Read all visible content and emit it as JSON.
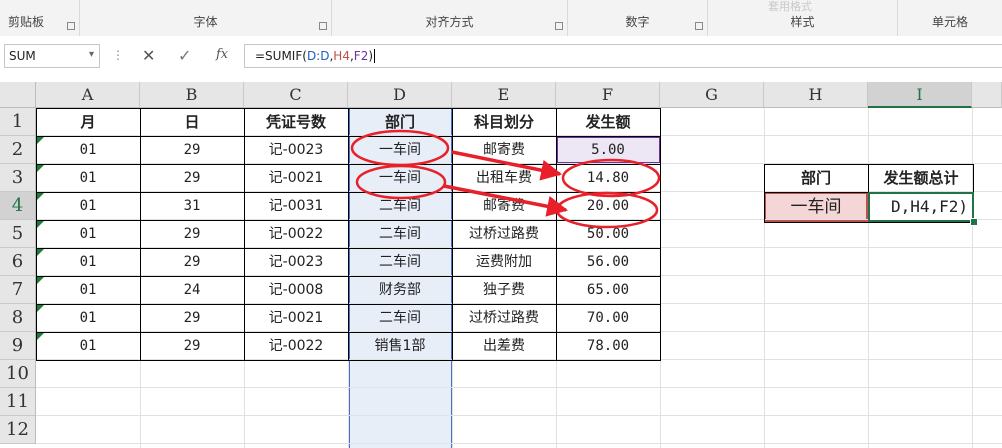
{
  "ribbon": {
    "groups": [
      "剪贴板",
      "字体",
      "对齐方式",
      "数字",
      "样式",
      "单元格"
    ],
    "ghost_text": "套用格式"
  },
  "formula_bar": {
    "name_box": "SUM",
    "cancel_icon": "✕",
    "enter_icon": "✓",
    "fx_label": "fx",
    "formula_prefix": "=SUMIF(",
    "formula_range": "D:D",
    "formula_comma1": ",",
    "formula_crit": "H4",
    "formula_comma2": ",",
    "formula_sum": "F2",
    "formula_suffix": ")"
  },
  "columns": [
    "A",
    "B",
    "C",
    "D",
    "E",
    "F",
    "G",
    "H",
    "I"
  ],
  "rows": [
    "1",
    "2",
    "3",
    "4",
    "5",
    "6",
    "7",
    "8",
    "9",
    "10",
    "11",
    "12"
  ],
  "table": {
    "headers": [
      "月",
      "日",
      "凭证号数",
      "部门",
      "科目划分",
      "发生额"
    ],
    "data": [
      [
        "01",
        "29",
        "记-0023",
        "一车间",
        "邮寄费",
        "5.00"
      ],
      [
        "01",
        "29",
        "记-0021",
        "一车间",
        "出租车费",
        "14.80"
      ],
      [
        "01",
        "31",
        "记-0031",
        "二车间",
        "邮寄费",
        "20.00"
      ],
      [
        "01",
        "29",
        "记-0022",
        "二车间",
        "过桥过路费",
        "50.00"
      ],
      [
        "01",
        "29",
        "记-0023",
        "二车间",
        "运费附加",
        "56.00"
      ],
      [
        "01",
        "24",
        "记-0008",
        "财务部",
        "独子费",
        "65.00"
      ],
      [
        "01",
        "29",
        "记-0021",
        "二车间",
        "过桥过路费",
        "70.00"
      ],
      [
        "01",
        "29",
        "记-0022",
        "销售1部",
        "出差费",
        "78.00"
      ]
    ]
  },
  "summary": {
    "header_dept": "部门",
    "header_total": "发生额总计",
    "dept_value": "一车间",
    "formula_tail": "D,H4,F2)"
  },
  "colors": {
    "excel_green": "#217346",
    "criteria_red": "#c0504d",
    "sum_purple": "#7030a0",
    "range_blue": "#4472c4",
    "annotation_red": "#e8202a"
  }
}
